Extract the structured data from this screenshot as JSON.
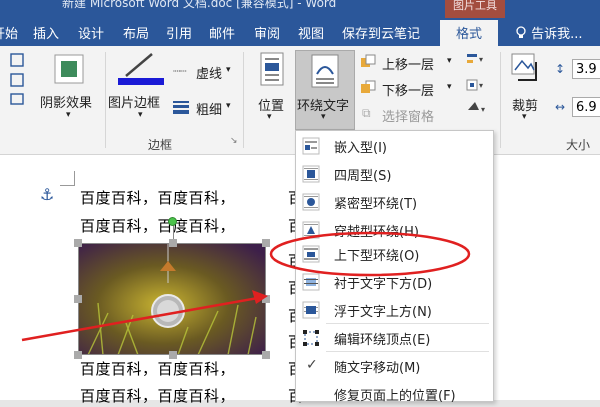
{
  "title_bar": {
    "title": "新建 Microsoft Word 文档.doc [兼容模式] - Word",
    "context_tab": "图片工具"
  },
  "tabs": [
    {
      "label": "开始"
    },
    {
      "label": "插入"
    },
    {
      "label": "设计"
    },
    {
      "label": "布局"
    },
    {
      "label": "引用"
    },
    {
      "label": "邮件"
    },
    {
      "label": "审阅"
    },
    {
      "label": "视图"
    },
    {
      "label": "保存到云笔记"
    },
    {
      "label": "格式"
    }
  ],
  "tell_me": "告诉我...",
  "ribbon": {
    "shadow_effect": "阴影效果",
    "picture_border": "图片边框",
    "dashes": "虚线",
    "weight": "粗细",
    "group_border": "边框",
    "position": "位置",
    "wrap_text": "环绕文字",
    "bring_forward": "上移一层",
    "send_backward": "下移一层",
    "selection_pane": "选择窗格",
    "crop": "裁剪",
    "group_size": "大小",
    "height_value": "3.9",
    "width_value": "6.9",
    "border_color": "#1a1ad6"
  },
  "document": {
    "lines": [
      "百度百科，百度百科，",
      "百度百科，百度百科，",
      "百度百科，百度百科，",
      "百度百科，百度百科，"
    ],
    "right_chars": [
      "百",
      "百",
      "百",
      "百",
      "百",
      "百",
      "百",
      "百"
    ]
  },
  "wrap_menu": {
    "items": [
      {
        "label": "嵌入型(I)",
        "icon": "inline-wrap-icon"
      },
      {
        "label": "四周型(S)",
        "icon": "square-wrap-icon"
      },
      {
        "label": "紧密型环绕(T)",
        "icon": "tight-wrap-icon"
      },
      {
        "label": "穿越型环绕(H)",
        "icon": "through-wrap-icon"
      },
      {
        "label": "上下型环绕(O)",
        "icon": "top-bottom-wrap-icon"
      },
      {
        "label": "衬于文字下方(D)",
        "icon": "behind-text-icon"
      },
      {
        "label": "浮于文字上方(N)",
        "icon": "in-front-text-icon"
      },
      {
        "label": "编辑环绕顶点(E)",
        "icon": "edit-wrap-points-icon"
      },
      {
        "label": "随文字移动(M)",
        "icon": "checkmark-icon"
      },
      {
        "label": "修复页面上的位置(F)",
        "icon": ""
      }
    ]
  }
}
